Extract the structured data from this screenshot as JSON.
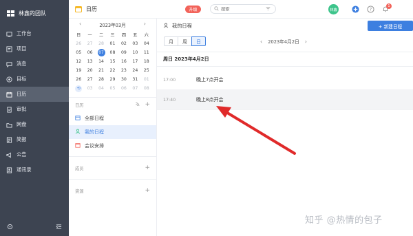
{
  "team": {
    "name": "林鑫的团队"
  },
  "sidebar": {
    "items": [
      {
        "label": "工作台",
        "icon": "dashboard-icon"
      },
      {
        "label": "项目",
        "icon": "project-icon"
      },
      {
        "label": "消息",
        "icon": "message-icon"
      },
      {
        "label": "目标",
        "icon": "target-icon"
      },
      {
        "label": "日历",
        "icon": "calendar-icon",
        "active": true
      },
      {
        "label": "审批",
        "icon": "approval-icon"
      },
      {
        "label": "网盘",
        "icon": "drive-icon"
      },
      {
        "label": "简报",
        "icon": "report-icon"
      },
      {
        "label": "公告",
        "icon": "announcement-icon"
      },
      {
        "label": "通讯录",
        "icon": "contacts-icon"
      }
    ]
  },
  "header": {
    "title": "日历",
    "upgrade_label": "升级",
    "search_placeholder": "搜索",
    "notification_count": "1",
    "avatar_text": "林鑫"
  },
  "mini_calendar": {
    "month_label": "2023年03月",
    "weekdays": [
      "日",
      "一",
      "二",
      "三",
      "四",
      "五",
      "六"
    ],
    "days": [
      [
        "26",
        "27",
        "28",
        "01",
        "02",
        "03",
        "04"
      ],
      [
        "05",
        "06",
        "07",
        "08",
        "09",
        "10",
        "11"
      ],
      [
        "12",
        "13",
        "14",
        "15",
        "16",
        "17",
        "18"
      ],
      [
        "19",
        "20",
        "21",
        "22",
        "23",
        "24",
        "25"
      ],
      [
        "26",
        "27",
        "28",
        "29",
        "30",
        "31",
        "01"
      ],
      [
        "⟲",
        "03",
        "04",
        "05",
        "06",
        "07",
        "08"
      ]
    ]
  },
  "calendar_section": {
    "title": "日历",
    "items": [
      {
        "label": "全部日程",
        "icon": "calendar-list-icon"
      },
      {
        "label": "我的日程",
        "icon": "person-icon",
        "active": true
      },
      {
        "label": "会议安排",
        "icon": "meeting-icon"
      }
    ],
    "members_label": "成员",
    "resources_label": "资源"
  },
  "main": {
    "title": "我的日程",
    "new_button": "+ 新建日程",
    "view_tabs": [
      "月",
      "周",
      "日"
    ],
    "active_view": "日",
    "current_date": "2023年4月2日",
    "day_heading": "周日 2023年4月2日",
    "events": [
      {
        "time": "17:00",
        "title": "晚上7点开会"
      },
      {
        "time": "17:40",
        "title": "晚上8点开会"
      }
    ]
  },
  "watermark": "知乎 @热情的包子",
  "colors": {
    "accent": "#3d7fe0",
    "sidebar": "#3d4451",
    "upgrade": "#f2635a",
    "arrow": "#e02a2a"
  }
}
